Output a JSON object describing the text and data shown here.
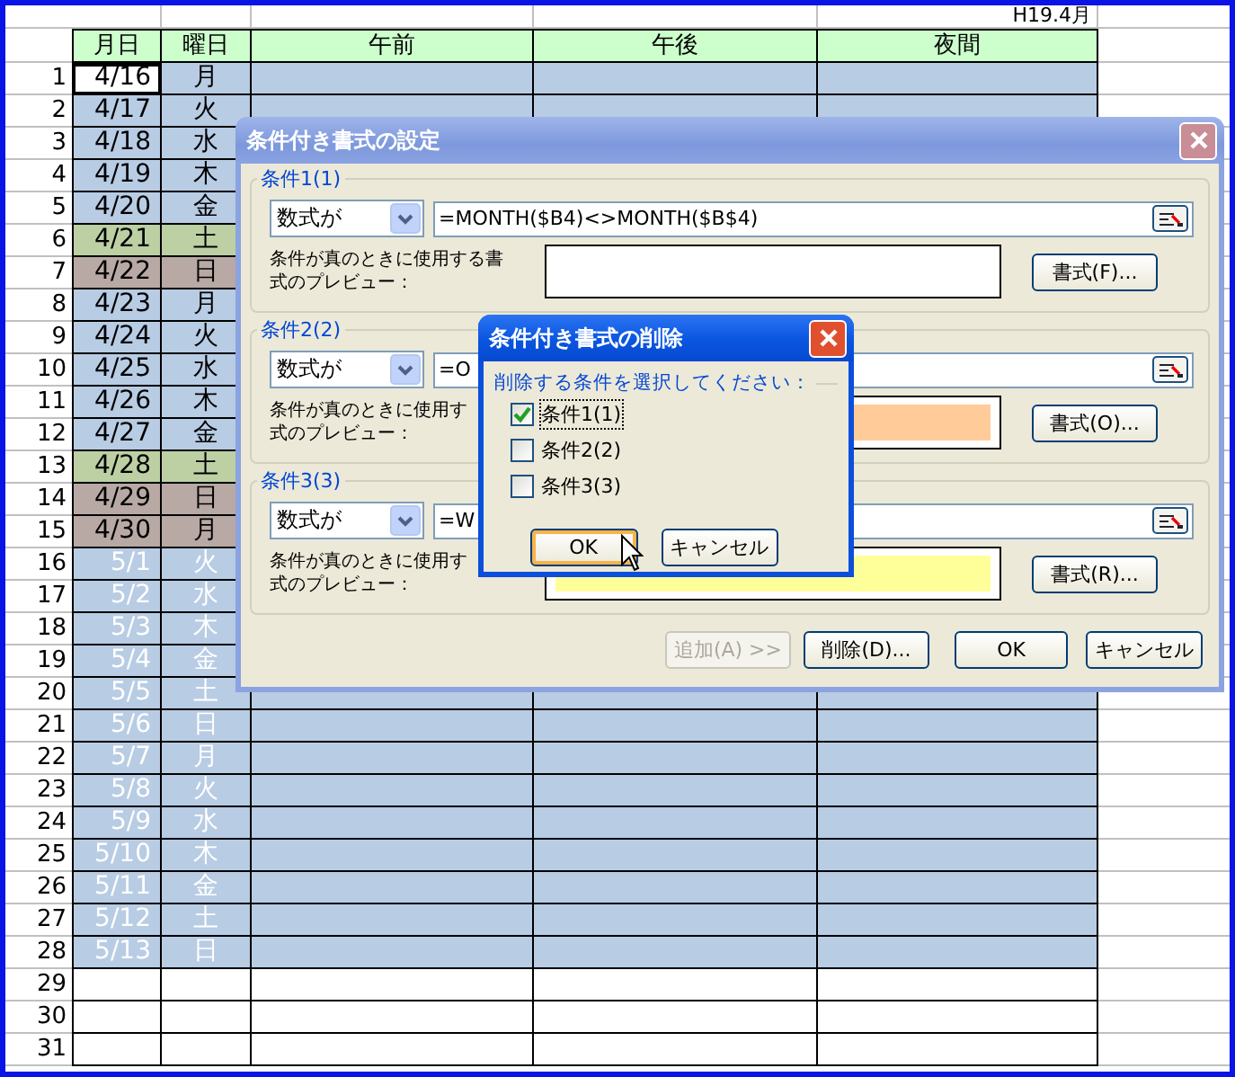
{
  "sheet": {
    "caption": "H19.4月",
    "columns": [
      "月日",
      "曜日",
      "午前",
      "午後",
      "夜間"
    ],
    "rows": [
      {
        "num": "1",
        "date": "4/16",
        "day": "月",
        "color": "#b8cce4",
        "other_month": false,
        "selected": true
      },
      {
        "num": "2",
        "date": "4/17",
        "day": "火",
        "color": "#b8cce4",
        "other_month": false,
        "selected": false
      },
      {
        "num": "3",
        "date": "4/18",
        "day": "水",
        "color": "#b8cce4",
        "other_month": false,
        "selected": false
      },
      {
        "num": "4",
        "date": "4/19",
        "day": "木",
        "color": "#b8cce4",
        "other_month": false,
        "selected": false
      },
      {
        "num": "5",
        "date": "4/20",
        "day": "金",
        "color": "#b8cce4",
        "other_month": false,
        "selected": false
      },
      {
        "num": "6",
        "date": "4/21",
        "day": "土",
        "color": "#bcd0a4",
        "other_month": false,
        "selected": false
      },
      {
        "num": "7",
        "date": "4/22",
        "day": "日",
        "color": "#b8a9a4",
        "other_month": false,
        "selected": false
      },
      {
        "num": "8",
        "date": "4/23",
        "day": "月",
        "color": "#b8cce4",
        "other_month": false,
        "selected": false
      },
      {
        "num": "9",
        "date": "4/24",
        "day": "火",
        "color": "#b8cce4",
        "other_month": false,
        "selected": false
      },
      {
        "num": "10",
        "date": "4/25",
        "day": "水",
        "color": "#b8cce4",
        "other_month": false,
        "selected": false
      },
      {
        "num": "11",
        "date": "4/26",
        "day": "木",
        "color": "#b8cce4",
        "other_month": false,
        "selected": false
      },
      {
        "num": "12",
        "date": "4/27",
        "day": "金",
        "color": "#b8cce4",
        "other_month": false,
        "selected": false
      },
      {
        "num": "13",
        "date": "4/28",
        "day": "土",
        "color": "#bcd0a4",
        "other_month": false,
        "selected": false
      },
      {
        "num": "14",
        "date": "4/29",
        "day": "日",
        "color": "#b8a9a4",
        "other_month": false,
        "selected": false
      },
      {
        "num": "15",
        "date": "4/30",
        "day": "月",
        "color": "#b8a9a4",
        "other_month": false,
        "selected": false
      },
      {
        "num": "16",
        "date": "5/1",
        "day": "火",
        "color": "#b8cce4",
        "other_month": true,
        "selected": false
      },
      {
        "num": "17",
        "date": "5/2",
        "day": "水",
        "color": "#b8cce4",
        "other_month": true,
        "selected": false
      },
      {
        "num": "18",
        "date": "5/3",
        "day": "木",
        "color": "#b8cce4",
        "other_month": true,
        "selected": false
      },
      {
        "num": "19",
        "date": "5/4",
        "day": "金",
        "color": "#b8cce4",
        "other_month": true,
        "selected": false
      },
      {
        "num": "20",
        "date": "5/5",
        "day": "土",
        "color": "#b8cce4",
        "other_month": true,
        "selected": false
      },
      {
        "num": "21",
        "date": "5/6",
        "day": "日",
        "color": "#b8cce4",
        "other_month": true,
        "selected": false
      },
      {
        "num": "22",
        "date": "5/7",
        "day": "月",
        "color": "#b8cce4",
        "other_month": true,
        "selected": false
      },
      {
        "num": "23",
        "date": "5/8",
        "day": "火",
        "color": "#b8cce4",
        "other_month": true,
        "selected": false
      },
      {
        "num": "24",
        "date": "5/9",
        "day": "水",
        "color": "#b8cce4",
        "other_month": true,
        "selected": false
      },
      {
        "num": "25",
        "date": "5/10",
        "day": "木",
        "color": "#b8cce4",
        "other_month": true,
        "selected": false
      },
      {
        "num": "26",
        "date": "5/11",
        "day": "金",
        "color": "#b8cce4",
        "other_month": true,
        "selected": false
      },
      {
        "num": "27",
        "date": "5/12",
        "day": "土",
        "color": "#b8cce4",
        "other_month": true,
        "selected": false
      },
      {
        "num": "28",
        "date": "5/13",
        "day": "日",
        "color": "#b8cce4",
        "other_month": true,
        "selected": false
      }
    ],
    "empty_rows": [
      "29",
      "30",
      "31"
    ]
  },
  "dialog": {
    "title": "条件付き書式の設定",
    "conditions": [
      {
        "label": "条件1(1)",
        "operator": "数式が",
        "formula": "=MONTH($B4)<>MONTH($B$4)",
        "preview_label_lines": [
          "条件が真のときに使用する書",
          "式のプレビュー："
        ],
        "color": "#ffffff",
        "format_button": "書式(F)..."
      },
      {
        "label": "条件2(2)",
        "operator": "数式が",
        "formula": "=O",
        "preview_label_lines": [
          "条件が真のときに使用す",
          "式のプレビュー："
        ],
        "color": "#ffcc99",
        "format_button": "書式(O)..."
      },
      {
        "label": "条件3(3)",
        "operator": "数式が",
        "formula": "=W",
        "preview_label_lines": [
          "条件が真のときに使用す",
          "式のプレビュー："
        ],
        "color": "#ffff99",
        "format_button": "書式(R)..."
      }
    ],
    "buttons": [
      {
        "label": "追加(A) >>",
        "disabled": true
      },
      {
        "label": "削除(D)...",
        "disabled": false
      },
      {
        "label": "OK",
        "disabled": false
      },
      {
        "label": "キャンセル",
        "disabled": false
      }
    ]
  },
  "delete_dialog": {
    "title": "条件付き書式の削除",
    "prompt": "削除する条件を選択してください：",
    "options": [
      {
        "label": "条件1(1)",
        "checked": true
      },
      {
        "label": "条件2(2)",
        "checked": false
      },
      {
        "label": "条件3(3)",
        "checked": false
      }
    ],
    "buttons": [
      {
        "label": "OK",
        "focused": true
      },
      {
        "label": "キャンセル",
        "focused": false
      }
    ]
  }
}
